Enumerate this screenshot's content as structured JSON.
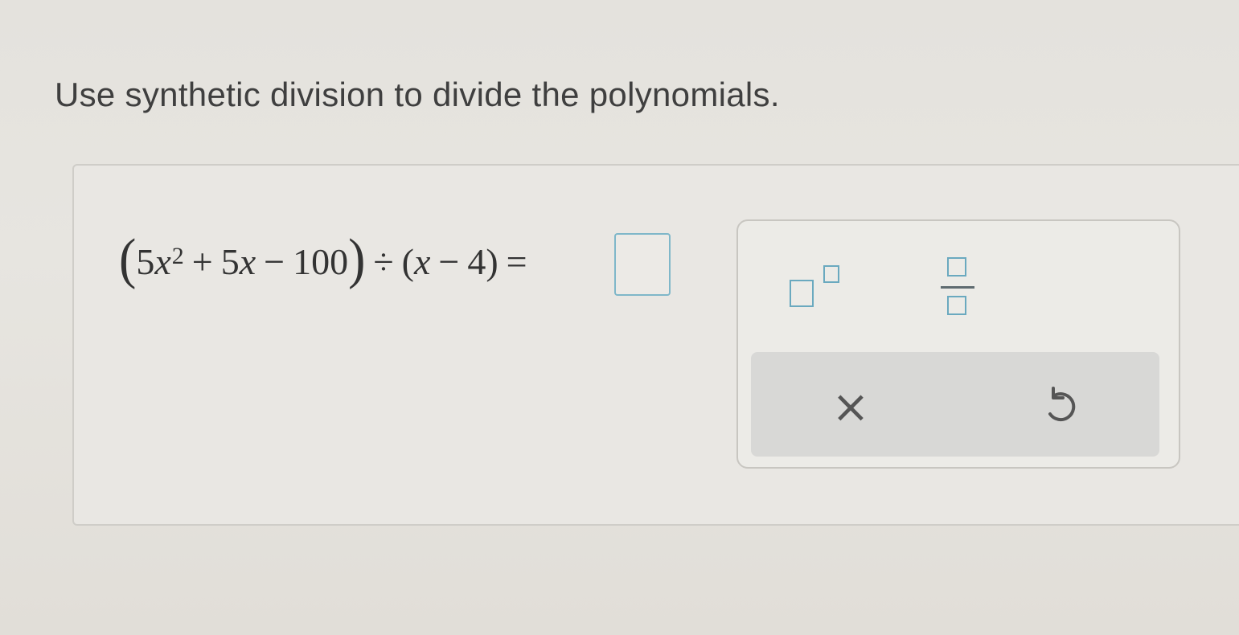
{
  "prompt": "Use synthetic division to divide the polynomials.",
  "equation": {
    "open_paren": "(",
    "coef1": "5",
    "var1": "x",
    "exp1": "2",
    "plus": "+",
    "coef2": "5",
    "var2": "x",
    "minus1": "−",
    "const1": "100",
    "close_paren": ")",
    "divide": "÷",
    "open_paren2": "(",
    "var3": "x",
    "minus2": "−",
    "const2": "4",
    "close_paren2": ")",
    "equals": "="
  },
  "answer": {
    "value": ""
  },
  "palette": {
    "exponent_icon": "exponent-template-icon",
    "fraction_icon": "fraction-template-icon",
    "clear_symbol": "×",
    "undo_icon": "undo-icon"
  },
  "colors": {
    "accent": "#6aa9bf",
    "text": "#333333"
  }
}
